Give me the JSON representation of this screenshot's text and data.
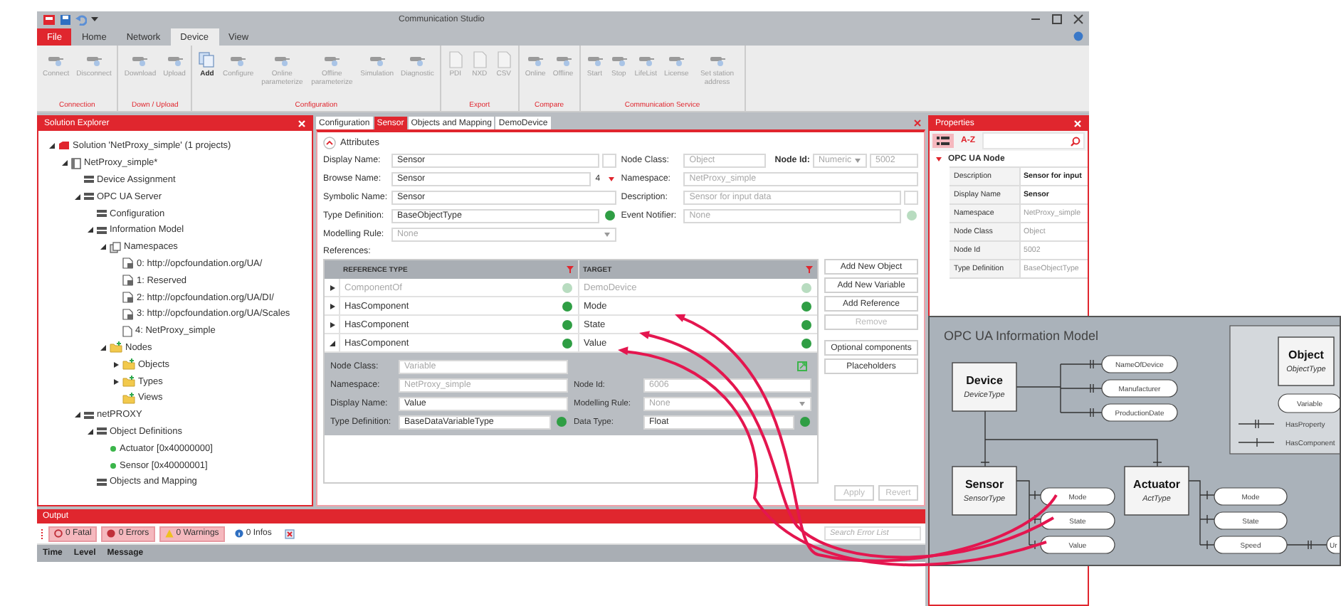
{
  "window": {
    "title": "Communication Studio"
  },
  "menu_tabs": [
    {
      "label": "File",
      "kind": "file",
      "selected": false
    },
    {
      "label": "Home",
      "kind": "tab",
      "selected": false
    },
    {
      "label": "Network",
      "kind": "tab",
      "selected": false
    },
    {
      "label": "Device",
      "kind": "tab",
      "selected": true
    },
    {
      "label": "View",
      "kind": "tab",
      "selected": false
    }
  ],
  "ribbon": [
    {
      "label": "Connection",
      "buttons": [
        {
          "label": "Connect",
          "disabled": true
        },
        {
          "label": "Disconnect",
          "disabled": true
        }
      ]
    },
    {
      "label": "Down / Upload",
      "buttons": [
        {
          "label": "Download",
          "disabled": true
        },
        {
          "label": "Upload",
          "disabled": true
        }
      ]
    },
    {
      "label": "Configuration",
      "buttons": [
        {
          "label": "Add",
          "disabled": false
        },
        {
          "label": "Configure",
          "disabled": true
        },
        {
          "label": "Online parameterize",
          "disabled": true
        },
        {
          "label": "Offline parameterize",
          "disabled": true
        },
        {
          "label": "Simulation",
          "disabled": true
        },
        {
          "label": "Diagnostic",
          "disabled": true
        }
      ]
    },
    {
      "label": "Export",
      "buttons": [
        {
          "label": "PDI",
          "disabled": true
        },
        {
          "label": "NXD",
          "disabled": true
        },
        {
          "label": "CSV",
          "disabled": true
        }
      ]
    },
    {
      "label": "Compare",
      "buttons": [
        {
          "label": "Online",
          "disabled": true
        },
        {
          "label": "Offline",
          "disabled": true
        }
      ]
    },
    {
      "label": "Communication Service",
      "buttons": [
        {
          "label": "Start",
          "disabled": true
        },
        {
          "label": "Stop",
          "disabled": true
        },
        {
          "label": "LifeList",
          "disabled": true
        },
        {
          "label": "License",
          "disabled": true
        },
        {
          "label": "Set station address",
          "disabled": true
        }
      ]
    }
  ],
  "solution_explorer": {
    "title": "Solution Explorer",
    "tree": [
      {
        "label": "Solution 'NetProxy_simple' (1 projects)",
        "kind": "solution",
        "expanded": true,
        "children": [
          {
            "label": "NetProxy_simple*",
            "kind": "project",
            "expanded": true,
            "children": [
              {
                "label": "Device Assignment",
                "kind": "module"
              },
              {
                "label": "OPC UA Server",
                "kind": "module",
                "expanded": true,
                "children": [
                  {
                    "label": "Configuration",
                    "kind": "module"
                  },
                  {
                    "label": "Information Model",
                    "kind": "module",
                    "expanded": true,
                    "children": [
                      {
                        "label": "Namespaces",
                        "kind": "namespaces",
                        "expanded": true,
                        "children": [
                          {
                            "label": "0: http://opcfoundation.org/UA/",
                            "kind": "nsdoc"
                          },
                          {
                            "label": "1: Reserved",
                            "kind": "nsdoc"
                          },
                          {
                            "label": "2: http://opcfoundation.org/UA/DI/",
                            "kind": "nsdoc"
                          },
                          {
                            "label": "3: http://opcfoundation.org/UA/Scales",
                            "kind": "nsdoc"
                          },
                          {
                            "label": "4: NetProxy_simple",
                            "kind": "doc"
                          }
                        ]
                      },
                      {
                        "label": "Nodes",
                        "kind": "folder",
                        "expanded": true,
                        "children": [
                          {
                            "label": "Objects",
                            "kind": "folder",
                            "expanded": false
                          },
                          {
                            "label": "Types",
                            "kind": "folder",
                            "expanded": false
                          },
                          {
                            "label": "Views",
                            "kind": "folder"
                          }
                        ]
                      }
                    ]
                  }
                ]
              },
              {
                "label": "netPROXY",
                "kind": "module",
                "expanded": true,
                "children": [
                  {
                    "label": "Object Definitions",
                    "kind": "module",
                    "expanded": true,
                    "children": [
                      {
                        "label": "Actuator [0x40000000]",
                        "kind": "dot"
                      },
                      {
                        "label": "Sensor [0x40000001]",
                        "kind": "dot"
                      }
                    ]
                  },
                  {
                    "label": "Objects and Mapping",
                    "kind": "module"
                  }
                ]
              }
            ]
          }
        ]
      }
    ]
  },
  "editor": {
    "tabs": [
      {
        "label": "Configuration",
        "selected": false
      },
      {
        "label": "Sensor",
        "selected": true
      },
      {
        "label": "Objects and Mapping",
        "selected": false
      },
      {
        "label": "DemoDevice",
        "selected": false
      }
    ],
    "section": "Attributes",
    "fields_left": [
      {
        "label": "Display Name:",
        "value": "Sensor",
        "disabled": false,
        "kind": "text_box"
      },
      {
        "label": "Browse Name:",
        "value": "Sensor",
        "disabled": false,
        "kind": "ns_select",
        "extra": "4"
      },
      {
        "label": "Symbolic Name:",
        "value": "Sensor",
        "disabled": false,
        "kind": "text"
      },
      {
        "label": "Type Definition:",
        "value": "BaseObjectType",
        "disabled": false,
        "kind": "lookup"
      },
      {
        "label": "Modelling Rule:",
        "value": "None",
        "disabled": true,
        "kind": "select"
      }
    ],
    "fields_right": [
      {
        "label": "Node Class:",
        "value": "Object",
        "disabled": true,
        "kind": "with_id",
        "id_label": "Node Id:",
        "id_type": "Numeric",
        "id_value": "5002"
      },
      {
        "label": "Namespace:",
        "value": "NetProxy_simple",
        "disabled": true,
        "kind": "text"
      },
      {
        "label": "Description:",
        "value": "Sensor for input data",
        "disabled": true,
        "kind": "text_box"
      },
      {
        "label": "Event Notifier:",
        "value": "None",
        "disabled": true,
        "kind": "lookup"
      }
    ],
    "references_label": "References:",
    "columns": [
      "REFERENCE TYPE",
      "TARGET"
    ],
    "rows": [
      {
        "type": "ComponentOf",
        "target": "DemoDevice",
        "expanded": false,
        "disabled": true
      },
      {
        "type": "HasComponent",
        "target": "Mode",
        "expanded": false,
        "disabled": false
      },
      {
        "type": "HasComponent",
        "target": "State",
        "expanded": false,
        "disabled": false
      },
      {
        "type": "HasComponent",
        "target": "Value",
        "expanded": true,
        "disabled": false
      }
    ],
    "detail_left": [
      {
        "label": "Node Class:",
        "value": "Variable",
        "disabled": true,
        "kind": "text"
      },
      {
        "label": "Namespace:",
        "value": "NetProxy_simple",
        "disabled": true,
        "kind": "text"
      },
      {
        "label": "Display Name:",
        "value": "Value",
        "disabled": false,
        "kind": "text"
      },
      {
        "label": "Type Definition:",
        "value": "BaseDataVariableType",
        "disabled": false,
        "kind": "lookup"
      }
    ],
    "detail_right": [
      {
        "label": "Node Id:",
        "value": "6006",
        "disabled": true,
        "kind": "text"
      },
      {
        "label": "Modelling Rule:",
        "value": "None",
        "disabled": true,
        "kind": "select"
      },
      {
        "label": "Data Type:",
        "value": "Float",
        "disabled": false,
        "kind": "lookup"
      }
    ],
    "side_buttons": [
      {
        "label": "Add New Object",
        "disabled": false
      },
      {
        "label": "Add New Variable",
        "disabled": false
      },
      {
        "label": "Add Reference",
        "disabled": false
      },
      {
        "label": "Remove",
        "disabled": true
      },
      {
        "label": "Optional components",
        "disabled": false
      },
      {
        "label": "Placeholders",
        "disabled": false
      }
    ],
    "footer_buttons": [
      {
        "label": "Apply",
        "disabled": true
      },
      {
        "label": "Revert",
        "disabled": true
      }
    ]
  },
  "properties": {
    "title": "Properties",
    "views": [
      {
        "kind": "categorized",
        "selected": true
      },
      {
        "kind": "alphabetical",
        "label": "A-Z",
        "selected": false
      }
    ],
    "category": "OPC UA Node",
    "rows": [
      {
        "label": "Description",
        "value": "Sensor for input",
        "bold": true
      },
      {
        "label": "Display Name",
        "value": "Sensor",
        "bold": true
      },
      {
        "label": "Namespace",
        "value": "NetProxy_simple",
        "bold": false
      },
      {
        "label": "Node Class",
        "value": "Object",
        "bold": false
      },
      {
        "label": "Node Id",
        "value": "5002",
        "bold": false
      },
      {
        "label": "Type Definition",
        "value": "BaseObjectType",
        "bold": false
      }
    ]
  },
  "output": {
    "title": "Output",
    "filters": [
      {
        "label": "0 Fatal",
        "kind": "fatal",
        "selected": true
      },
      {
        "label": "0 Errors",
        "kind": "error",
        "selected": true
      },
      {
        "label": "0 Warnings",
        "kind": "warning",
        "selected": true
      },
      {
        "label": "0 Infos",
        "kind": "info",
        "selected": false
      }
    ],
    "search": {
      "placeholder": "Search Error List"
    },
    "columns": [
      "Time",
      "Level",
      "Message"
    ]
  },
  "diagram": {
    "title": "OPC UA Information Model",
    "classes": [
      {
        "name": "Device",
        "type": "DeviceType"
      },
      {
        "name": "Sensor",
        "type": "SensorType"
      },
      {
        "name": "Actuator",
        "type": "ActType"
      }
    ],
    "device_properties": [
      "NameOfDevice",
      "Manufacturer",
      "ProductionDate"
    ],
    "sensor_variables": [
      "Mode",
      "State",
      "Value"
    ],
    "actuator_variables": [
      "Mode",
      "State",
      "Speed"
    ],
    "speed_property": "Ur",
    "legend": {
      "object_name": "Object",
      "object_type": "ObjectType",
      "variable": "Variable",
      "has_property": "HasProperty",
      "has_component": "HasComponent"
    }
  }
}
